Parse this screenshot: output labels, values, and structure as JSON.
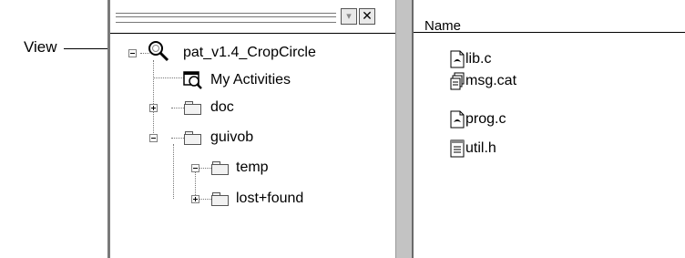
{
  "callout": {
    "label": "View"
  },
  "tree": {
    "root": "pat_v1.4_CropCircle",
    "activities": "My Activities",
    "doc": "doc",
    "guivob": "guivob",
    "temp": "temp",
    "lost_found": "lost+found"
  },
  "list": {
    "column_header": "Name",
    "files": [
      {
        "name": "lib.c",
        "icon": "c-source-file-icon"
      },
      {
        "name": "msg.cat",
        "icon": "catalog-file-icon"
      },
      {
        "name": "prog.c",
        "icon": "c-source-file-icon"
      },
      {
        "name": "util.h",
        "icon": "header-file-icon"
      }
    ]
  },
  "header_buttons": {
    "dropdown": "▾",
    "close": "✕"
  }
}
